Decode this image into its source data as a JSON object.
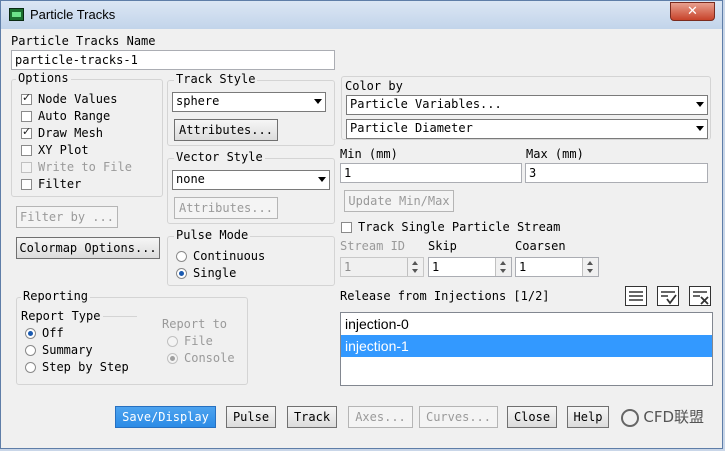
{
  "window": {
    "title": "Particle Tracks",
    "close_glyph": "✕"
  },
  "name_section": {
    "label": "Particle Tracks Name",
    "value": "particle-tracks-1"
  },
  "options": {
    "label": "Options",
    "items": [
      {
        "label": "Node Values",
        "checked": true,
        "disabled": false
      },
      {
        "label": "Auto Range",
        "checked": false,
        "disabled": false
      },
      {
        "label": "Draw Mesh",
        "checked": true,
        "disabled": false
      },
      {
        "label": "XY Plot",
        "checked": false,
        "disabled": false
      },
      {
        "label": "Write to File",
        "checked": false,
        "disabled": true
      },
      {
        "label": "Filter",
        "checked": false,
        "disabled": false
      }
    ]
  },
  "filter_by_button": "Filter by ...",
  "colormap_button": "Colormap Options...",
  "track_style": {
    "label": "Track Style",
    "value": "sphere",
    "attributes_button": "Attributes..."
  },
  "vector_style": {
    "label": "Vector Style",
    "value": "none",
    "attributes_button": "Attributes..."
  },
  "pulse_mode": {
    "label": "Pulse Mode",
    "continuous": "Continuous",
    "single": "Single",
    "selected": "Single"
  },
  "reporting": {
    "label": "Reporting",
    "report_type_label": "Report Type",
    "types": [
      "Off",
      "Summary",
      "Step by Step"
    ],
    "selected_type": "Off",
    "report_to_label": "Report to",
    "targets": [
      "File",
      "Console"
    ],
    "selected_target": "Console"
  },
  "color_by": {
    "label": "Color by",
    "category": "Particle Variables...",
    "variable": "Particle Diameter"
  },
  "range": {
    "min_label": "Min (mm)",
    "max_label": "Max (mm)",
    "min_value": "1",
    "max_value": "3",
    "update_button": "Update Min/Max"
  },
  "track_single": {
    "label": "Track Single Particle Stream",
    "checked": false
  },
  "stream": {
    "stream_id_label": "Stream ID",
    "stream_id_value": "1",
    "skip_label": "Skip",
    "skip_value": "1",
    "coarsen_label": "Coarsen",
    "coarsen_value": "1"
  },
  "injections": {
    "label": "Release from Injections [1/2]",
    "items": [
      "injection-0",
      "injection-1"
    ],
    "selected_index": 1
  },
  "buttons": {
    "save_display": "Save/Display",
    "pulse": "Pulse",
    "track": "Track",
    "axes": "Axes...",
    "curves": "Curves...",
    "close": "Close",
    "help": "Help"
  },
  "watermark": "CFD联盟"
}
